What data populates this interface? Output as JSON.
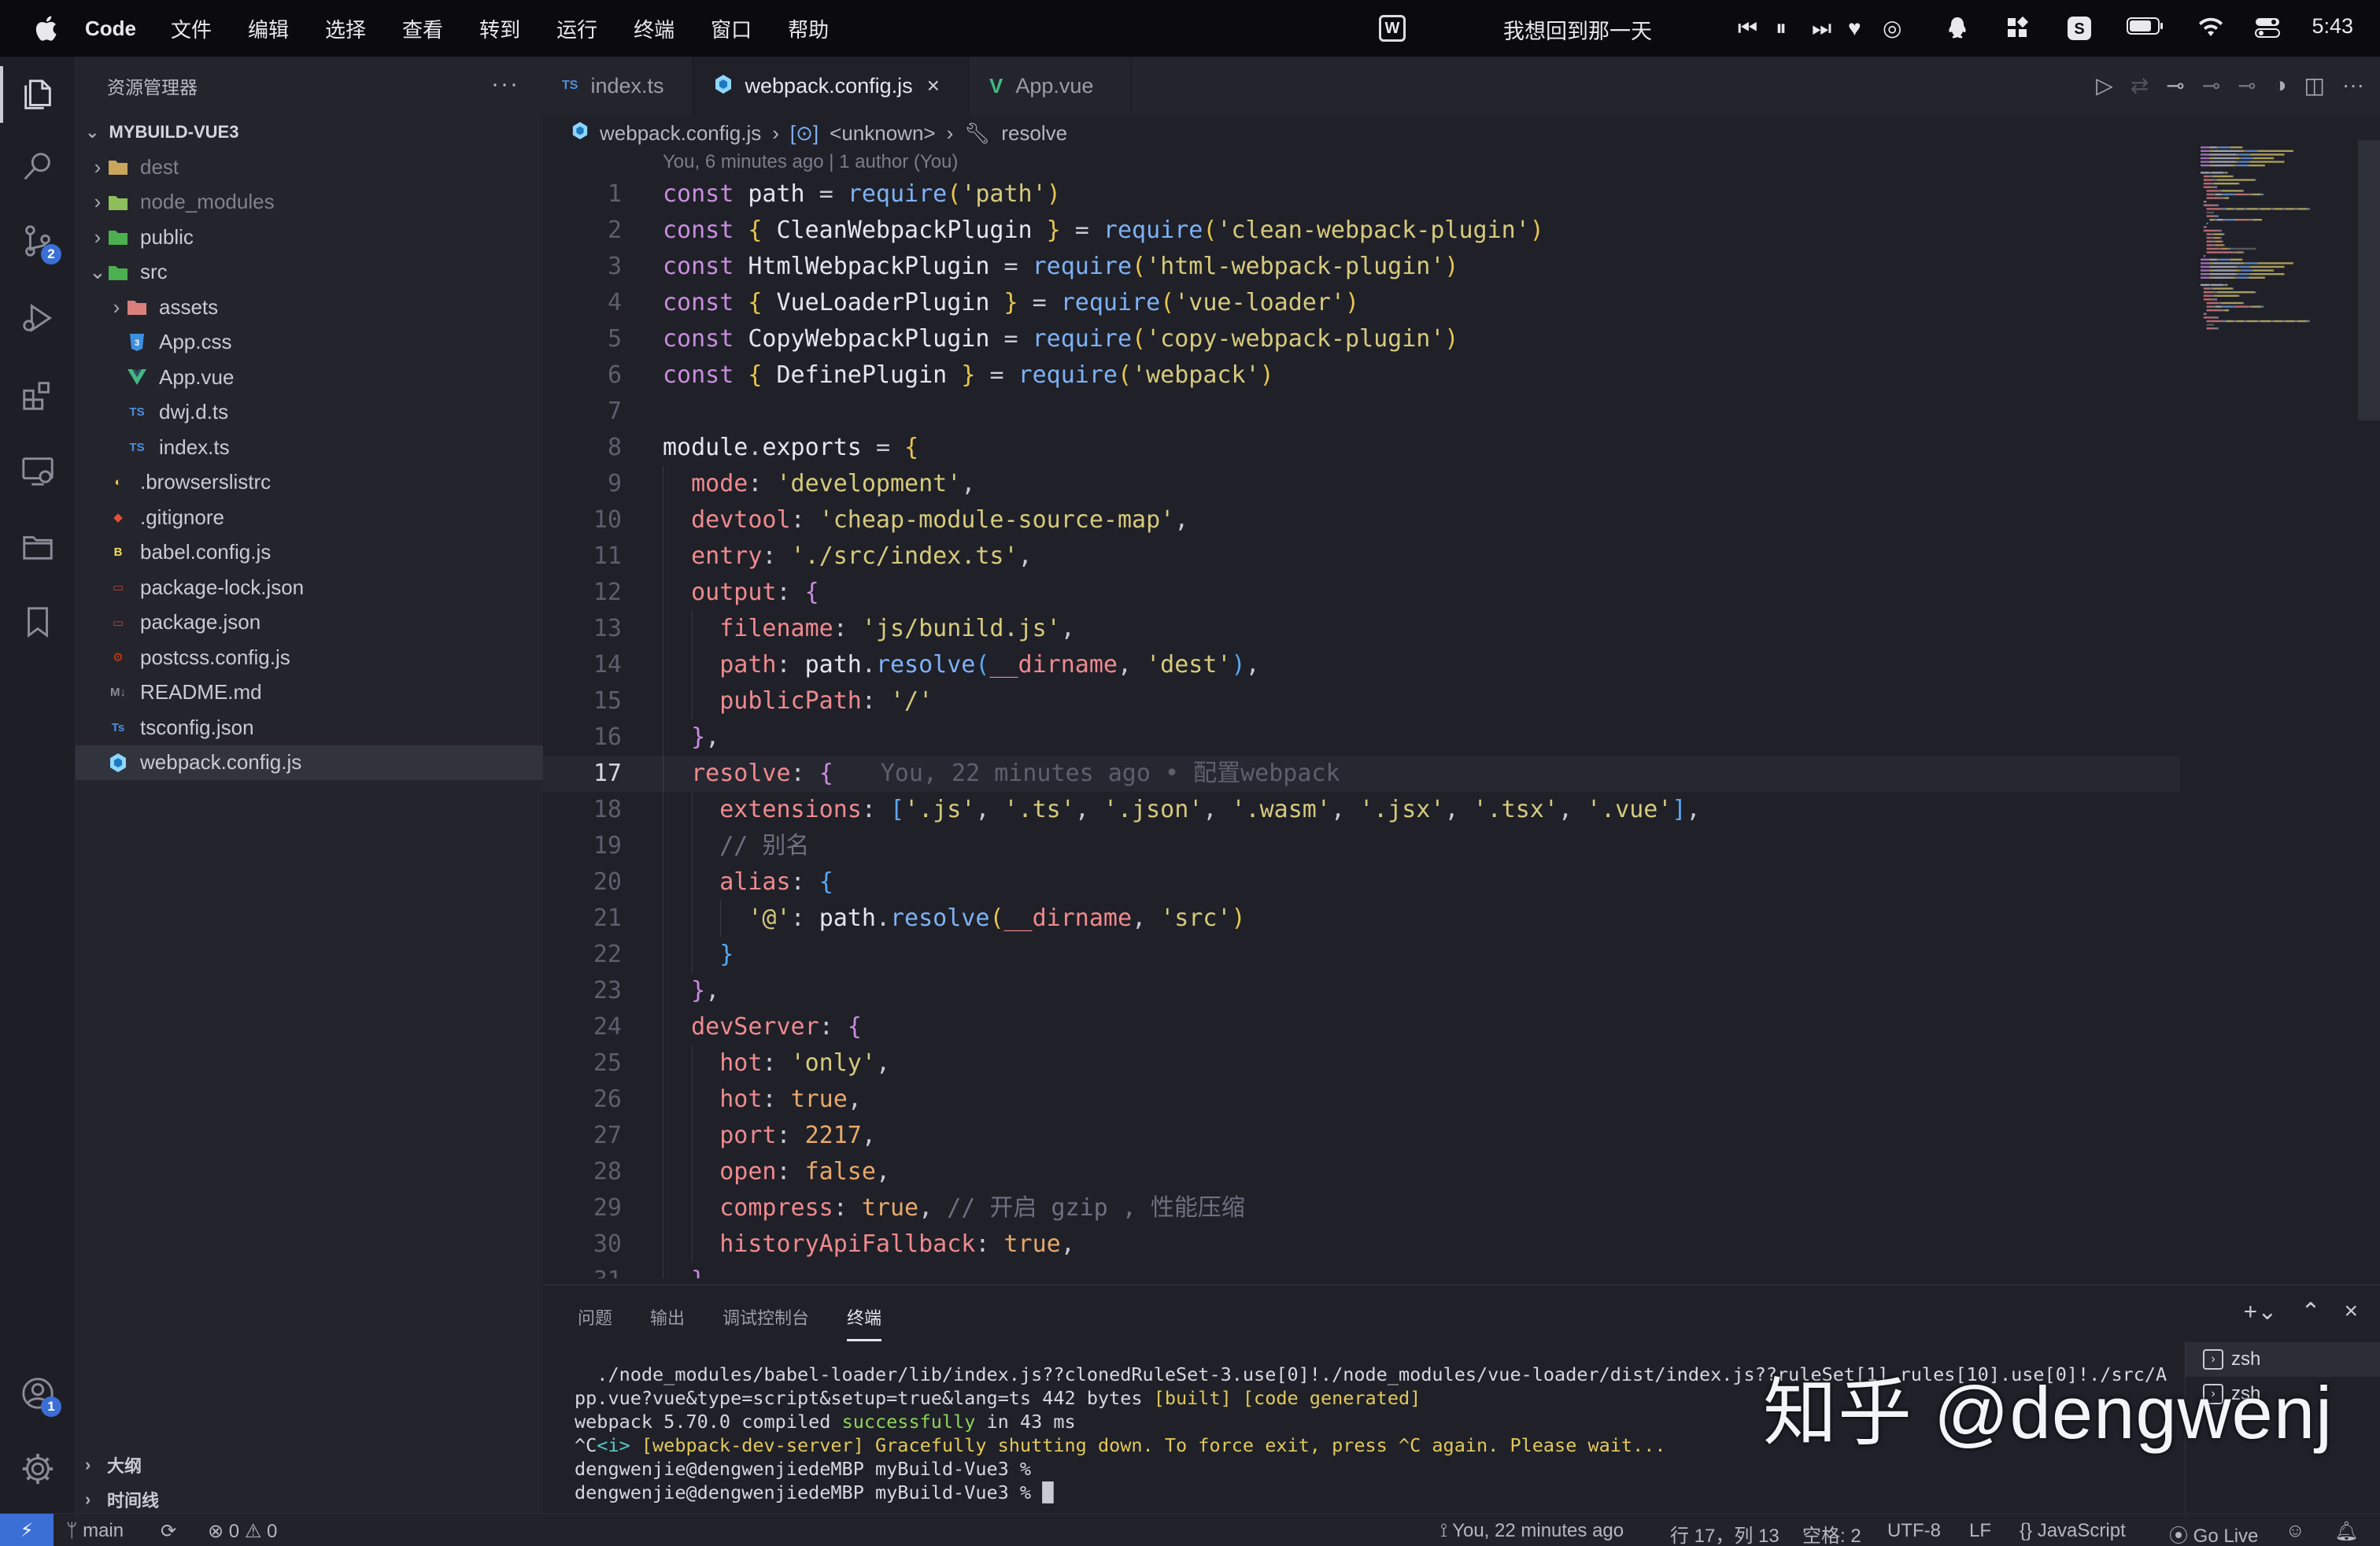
{
  "menubar": {
    "app_name": "Code",
    "items": [
      "文件",
      "编辑",
      "选择",
      "查看",
      "转到",
      "运行",
      "终端",
      "窗口",
      "帮助"
    ],
    "now_playing": "我想回到那一天",
    "wps_label": "W",
    "clock": "5:43"
  },
  "activity": {
    "scm_badge": "2",
    "account_badge": "1"
  },
  "sidebar": {
    "title": "资源管理器",
    "more": "···",
    "project": "MYBUILD-VUE3",
    "tree": [
      {
        "name": "dest",
        "kind": "folder",
        "depth": 0,
        "dim": true
      },
      {
        "name": "node_modules",
        "kind": "folder",
        "depth": 0,
        "dim": true
      },
      {
        "name": "public",
        "kind": "folder",
        "depth": 0
      },
      {
        "name": "src",
        "kind": "folder-open",
        "depth": 0
      },
      {
        "name": "assets",
        "kind": "folder",
        "depth": 1
      },
      {
        "name": "App.css",
        "kind": "css",
        "depth": 1
      },
      {
        "name": "App.vue",
        "kind": "vue",
        "depth": 1
      },
      {
        "name": "dwj.d.ts",
        "kind": "ts",
        "depth": 1
      },
      {
        "name": "index.ts",
        "kind": "ts",
        "depth": 1
      },
      {
        "name": ".browserslistrc",
        "kind": "browserslist",
        "depth": 0
      },
      {
        "name": ".gitignore",
        "kind": "git",
        "depth": 0
      },
      {
        "name": "babel.config.js",
        "kind": "babel",
        "depth": 0
      },
      {
        "name": "package-lock.json",
        "kind": "npm",
        "depth": 0
      },
      {
        "name": "package.json",
        "kind": "npm",
        "depth": 0
      },
      {
        "name": "postcss.config.js",
        "kind": "postcss",
        "depth": 0
      },
      {
        "name": "README.md",
        "kind": "md",
        "depth": 0
      },
      {
        "name": "tsconfig.json",
        "kind": "tsconfig",
        "depth": 0
      },
      {
        "name": "webpack.config.js",
        "kind": "webpack",
        "depth": 0,
        "selected": true
      }
    ],
    "outline_label": "大纲",
    "timeline_label": "时间线"
  },
  "tabs": [
    {
      "label": "index.ts",
      "icon": "TS",
      "active": false
    },
    {
      "label": "webpack.config.js",
      "icon": "webpack",
      "active": true,
      "close": "×"
    },
    {
      "label": "App.vue",
      "icon": "V",
      "active": false
    }
  ],
  "breadcrumb": {
    "file": "webpack.config.js",
    "symbol": "<unknown>",
    "member": "resolve"
  },
  "blame_header": "You, 6 minutes ago | 1 author (You)",
  "code": {
    "current_line": 17,
    "inline_blame": "You, 22 minutes ago • 配置webpack",
    "lines": [
      [
        [
          "kw",
          "const "
        ],
        [
          "var",
          "path "
        ],
        [
          "pun",
          "= "
        ],
        [
          "fn",
          "require"
        ],
        [
          "br1",
          "("
        ],
        [
          "str",
          "'path'"
        ],
        [
          "br1",
          ")"
        ]
      ],
      [
        [
          "kw",
          "const "
        ],
        [
          "br1",
          "{ "
        ],
        [
          "var",
          "CleanWebpackPlugin "
        ],
        [
          "br1",
          "} "
        ],
        [
          "pun",
          "= "
        ],
        [
          "fn",
          "require"
        ],
        [
          "br1",
          "("
        ],
        [
          "str",
          "'clean-webpack-plugin'"
        ],
        [
          "br1",
          ")"
        ]
      ],
      [
        [
          "kw",
          "const "
        ],
        [
          "var",
          "HtmlWebpackPlugin "
        ],
        [
          "pun",
          "= "
        ],
        [
          "fn",
          "require"
        ],
        [
          "br1",
          "("
        ],
        [
          "str",
          "'html-webpack-plugin'"
        ],
        [
          "br1",
          ")"
        ]
      ],
      [
        [
          "kw",
          "const "
        ],
        [
          "br1",
          "{ "
        ],
        [
          "var",
          "VueLoaderPlugin "
        ],
        [
          "br1",
          "} "
        ],
        [
          "pun",
          "= "
        ],
        [
          "fn",
          "require"
        ],
        [
          "br1",
          "("
        ],
        [
          "str",
          "'vue-loader'"
        ],
        [
          "br1",
          ")"
        ]
      ],
      [
        [
          "kw",
          "const "
        ],
        [
          "var",
          "CopyWebpackPlugin "
        ],
        [
          "pun",
          "= "
        ],
        [
          "fn",
          "require"
        ],
        [
          "br1",
          "("
        ],
        [
          "str",
          "'copy-webpack-plugin'"
        ],
        [
          "br1",
          ")"
        ]
      ],
      [
        [
          "kw",
          "const "
        ],
        [
          "br1",
          "{ "
        ],
        [
          "var",
          "DefinePlugin "
        ],
        [
          "br1",
          "} "
        ],
        [
          "pun",
          "= "
        ],
        [
          "fn",
          "require"
        ],
        [
          "br1",
          "("
        ],
        [
          "str",
          "'webpack'"
        ],
        [
          "br1",
          ")"
        ]
      ],
      [],
      [
        [
          "var",
          "module"
        ],
        [
          "pun",
          "."
        ],
        [
          "var",
          "exports "
        ],
        [
          "pun",
          "= "
        ],
        [
          "br1",
          "{"
        ]
      ],
      [
        [
          "pun",
          "  "
        ],
        [
          "prop",
          "mode"
        ],
        [
          "pun",
          ": "
        ],
        [
          "str",
          "'development'"
        ],
        [
          "pun",
          ","
        ]
      ],
      [
        [
          "pun",
          "  "
        ],
        [
          "prop",
          "devtool"
        ],
        [
          "pun",
          ": "
        ],
        [
          "str",
          "'cheap-module-source-map'"
        ],
        [
          "pun",
          ","
        ]
      ],
      [
        [
          "pun",
          "  "
        ],
        [
          "prop",
          "entry"
        ],
        [
          "pun",
          ": "
        ],
        [
          "str",
          "'./src/index.ts'"
        ],
        [
          "pun",
          ","
        ]
      ],
      [
        [
          "pun",
          "  "
        ],
        [
          "prop",
          "output"
        ],
        [
          "pun",
          ": "
        ],
        [
          "br2",
          "{"
        ]
      ],
      [
        [
          "pun",
          "    "
        ],
        [
          "prop",
          "filename"
        ],
        [
          "pun",
          ": "
        ],
        [
          "str",
          "'js/bunild.js'"
        ],
        [
          "pun",
          ","
        ]
      ],
      [
        [
          "pun",
          "    "
        ],
        [
          "prop",
          "path"
        ],
        [
          "pun",
          ": "
        ],
        [
          "var",
          "path"
        ],
        [
          "pun",
          "."
        ],
        [
          "fn",
          "resolve"
        ],
        [
          "br3",
          "("
        ],
        [
          "prop",
          "__dirname"
        ],
        [
          "pun",
          ", "
        ],
        [
          "str",
          "'dest'"
        ],
        [
          "br3",
          ")"
        ],
        [
          "pun",
          ","
        ]
      ],
      [
        [
          "pun",
          "    "
        ],
        [
          "prop",
          "publicPath"
        ],
        [
          "pun",
          ": "
        ],
        [
          "str",
          "'/'"
        ]
      ],
      [
        [
          "pun",
          "  "
        ],
        [
          "br2",
          "}"
        ],
        [
          "pun",
          ","
        ]
      ],
      [
        [
          "pun",
          "  "
        ],
        [
          "prop",
          "resolve"
        ],
        [
          "pun",
          ": "
        ],
        [
          "br2",
          "{"
        ]
      ],
      [
        [
          "pun",
          "    "
        ],
        [
          "prop",
          "extensions"
        ],
        [
          "pun",
          ": "
        ],
        [
          "br3",
          "["
        ],
        [
          "str",
          "'.js'"
        ],
        [
          "pun",
          ", "
        ],
        [
          "str",
          "'.ts'"
        ],
        [
          "pun",
          ", "
        ],
        [
          "str",
          "'.json'"
        ],
        [
          "pun",
          ", "
        ],
        [
          "str",
          "'.wasm'"
        ],
        [
          "pun",
          ", "
        ],
        [
          "str",
          "'.jsx'"
        ],
        [
          "pun",
          ", "
        ],
        [
          "str",
          "'.tsx'"
        ],
        [
          "pun",
          ", "
        ],
        [
          "str",
          "'.vue'"
        ],
        [
          "br3",
          "]"
        ],
        [
          "pun",
          ","
        ]
      ],
      [
        [
          "pun",
          "    "
        ],
        [
          "cmt",
          "// 别名"
        ]
      ],
      [
        [
          "pun",
          "    "
        ],
        [
          "prop",
          "alias"
        ],
        [
          "pun",
          ": "
        ],
        [
          "br3",
          "{"
        ]
      ],
      [
        [
          "pun",
          "      "
        ],
        [
          "str",
          "'@'"
        ],
        [
          "pun",
          ": "
        ],
        [
          "var",
          "path"
        ],
        [
          "pun",
          "."
        ],
        [
          "fn",
          "resolve"
        ],
        [
          "br1",
          "("
        ],
        [
          "prop",
          "__dirname"
        ],
        [
          "pun",
          ", "
        ],
        [
          "str",
          "'src'"
        ],
        [
          "br1",
          ")"
        ]
      ],
      [
        [
          "pun",
          "    "
        ],
        [
          "br3",
          "}"
        ]
      ],
      [
        [
          "pun",
          "  "
        ],
        [
          "br2",
          "}"
        ],
        [
          "pun",
          ","
        ]
      ],
      [
        [
          "pun",
          "  "
        ],
        [
          "prop",
          "devServer"
        ],
        [
          "pun",
          ": "
        ],
        [
          "br2",
          "{"
        ]
      ],
      [
        [
          "pun",
          "    "
        ],
        [
          "prop",
          "hot"
        ],
        [
          "pun",
          ": "
        ],
        [
          "str",
          "'only'"
        ],
        [
          "pun",
          ","
        ]
      ],
      [
        [
          "pun",
          "    "
        ],
        [
          "prop",
          "hot"
        ],
        [
          "pun",
          ": "
        ],
        [
          "num",
          "true"
        ],
        [
          "pun",
          ","
        ]
      ],
      [
        [
          "pun",
          "    "
        ],
        [
          "prop",
          "port"
        ],
        [
          "pun",
          ": "
        ],
        [
          "num",
          "2217"
        ],
        [
          "pun",
          ","
        ]
      ],
      [
        [
          "pun",
          "    "
        ],
        [
          "prop",
          "open"
        ],
        [
          "pun",
          ": "
        ],
        [
          "num",
          "false"
        ],
        [
          "pun",
          ","
        ]
      ],
      [
        [
          "pun",
          "    "
        ],
        [
          "prop",
          "compress"
        ],
        [
          "pun",
          ": "
        ],
        [
          "num",
          "true"
        ],
        [
          "pun",
          ", "
        ],
        [
          "cmt",
          "// 开启 gzip , 性能压缩"
        ]
      ],
      [
        [
          "pun",
          "    "
        ],
        [
          "prop",
          "historyApiFallback"
        ],
        [
          "pun",
          ": "
        ],
        [
          "num",
          "true"
        ],
        [
          "pun",
          ","
        ]
      ],
      [
        [
          "pun",
          "  "
        ],
        [
          "br2",
          "}"
        ]
      ]
    ]
  },
  "panel": {
    "tabs": [
      "问题",
      "输出",
      "调试控制台",
      "终端"
    ],
    "active_tab": "终端",
    "terminals": [
      "zsh",
      "zsh"
    ],
    "output": [
      [
        [
          "",
          "  ./node_modules/babel-loader/lib/index.js??clonedRuleSet-3.use[0]!./node_modules/vue-loader/dist/index.js??ruleSet[1].rules[10].use[0]!./src/A"
        ]
      ],
      [
        [
          "",
          "pp.vue?vue&type=script&setup=true&lang=ts 442 bytes "
        ],
        [
          "t-yellow",
          "[built] [code generated]"
        ]
      ],
      [
        [
          "",
          "webpack 5.70.0 compiled "
        ],
        [
          "t-green",
          "successfully"
        ],
        [
          "",
          " in 43 ms"
        ]
      ],
      [
        [
          "",
          "^C"
        ],
        [
          "t-cyan",
          "<i> "
        ],
        [
          "t-yellow",
          "[webpack-dev-server] Gracefully shutting down. To force exit, press ^C again. Please wait..."
        ]
      ],
      [
        [
          "",
          "dengwenjie@dengwenjiedeMBP myBuild-Vue3 %"
        ]
      ],
      [
        [
          "",
          "dengwenjie@dengwenjiedeMBP myBuild-Vue3 % "
        ],
        [
          "cursor",
          "█"
        ]
      ]
    ],
    "watermark": "知乎 @dengwenj"
  },
  "statusbar": {
    "branch": "main",
    "errors": "0",
    "warnings": "0",
    "blame": "You, 22 minutes ago",
    "position": "行 17，列 13",
    "indent": "空格: 2",
    "encoding": "UTF-8",
    "eol": "LF",
    "language": "JavaScript",
    "golive": "Go Live"
  },
  "colors": {
    "accent": "#3b6fd6",
    "editor_bg": "#1f2028",
    "sidebar_bg": "#23242c"
  }
}
